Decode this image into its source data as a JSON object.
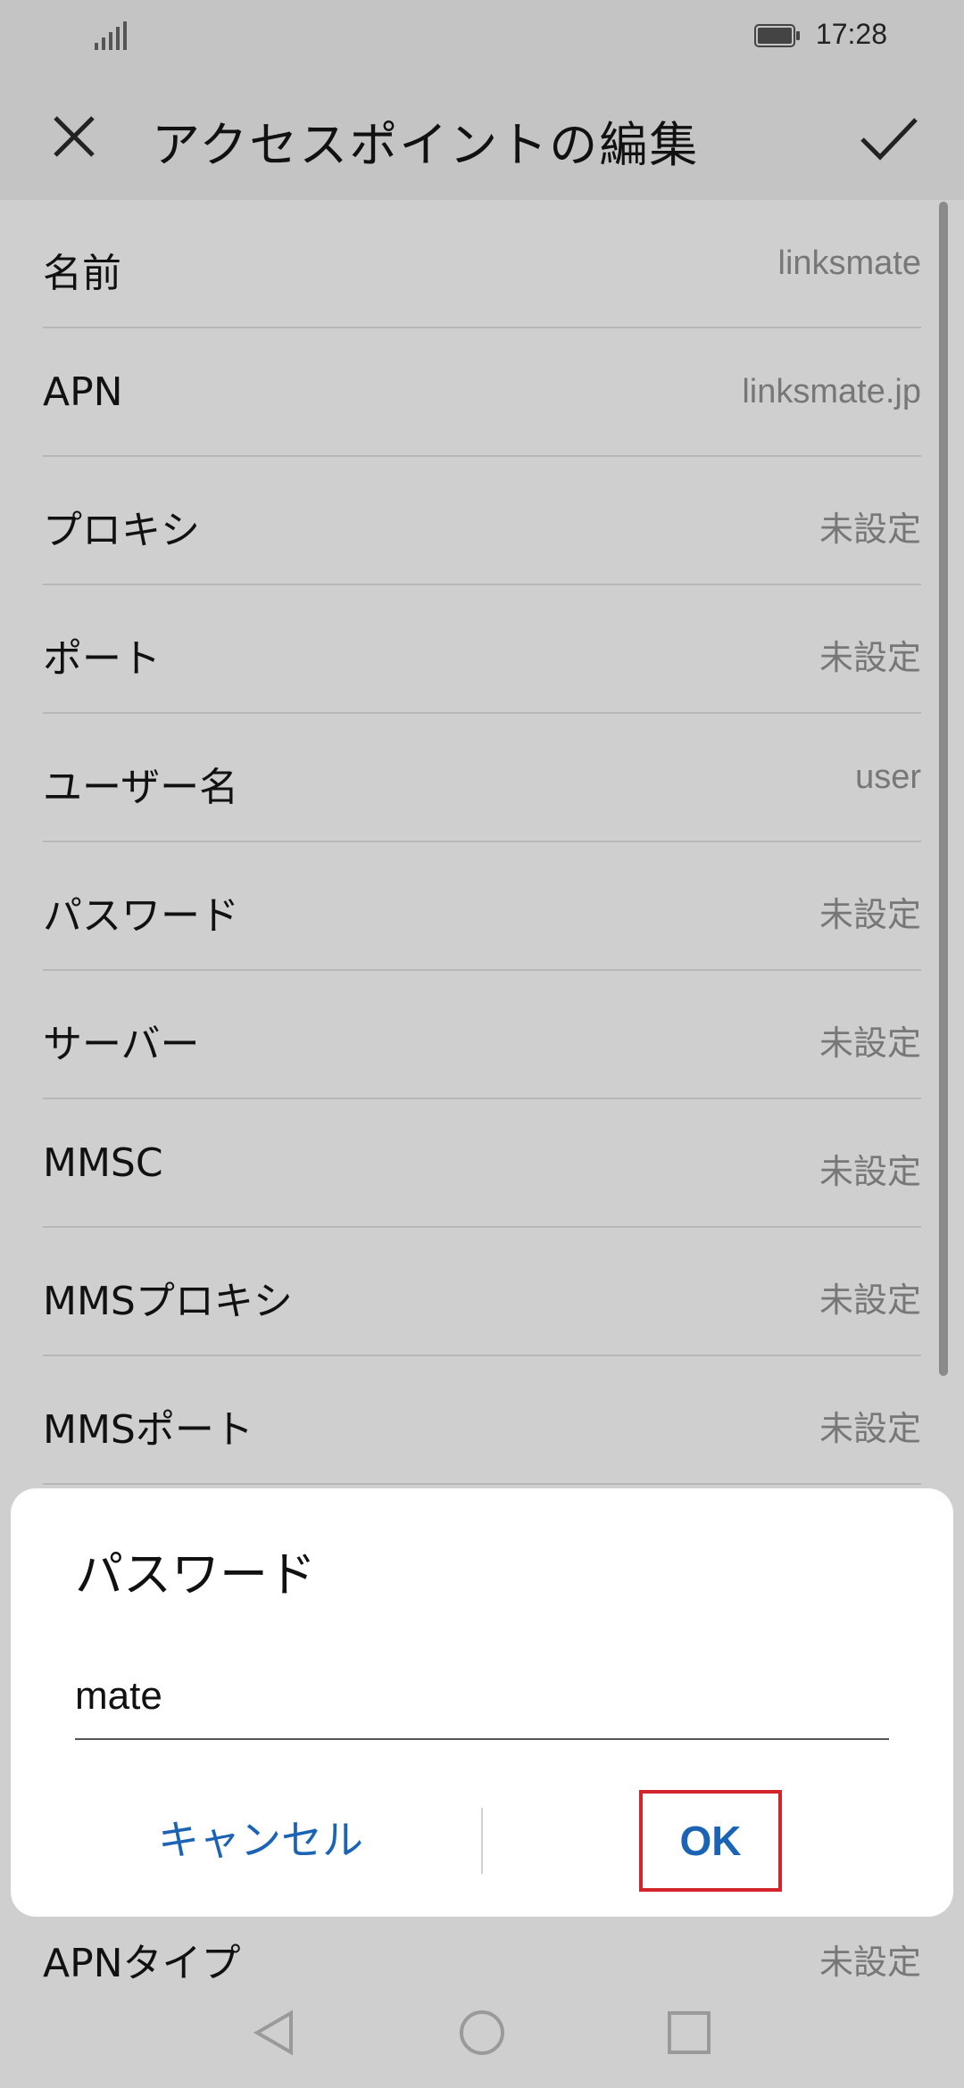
{
  "status_bar": {
    "time": "17:28"
  },
  "app_bar": {
    "title": "アクセスポイントの編集"
  },
  "rows": [
    {
      "label": "名前",
      "value": "linksmate"
    },
    {
      "label": "APN",
      "value": "linksmate.jp"
    },
    {
      "label": "プロキシ",
      "value": "未設定"
    },
    {
      "label": "ポート",
      "value": "未設定"
    },
    {
      "label": "ユーザー名",
      "value": "user"
    },
    {
      "label": "パスワード",
      "value": "未設定"
    },
    {
      "label": "サーバー",
      "value": "未設定"
    },
    {
      "label": "MMSC",
      "value": "未設定"
    },
    {
      "label": "MMSプロキシ",
      "value": "未設定"
    },
    {
      "label": "MMSポート",
      "value": "未設定"
    },
    {
      "label": "APNタイプ",
      "value": "未設定"
    }
  ],
  "dialog": {
    "title": "パスワード",
    "input_value": "mate",
    "cancel_label": "キャンセル",
    "ok_label": "OK"
  },
  "colors": {
    "accent": "#1a63b5",
    "highlight": "#d4242b",
    "dim_overlay": "#cfcfcf"
  },
  "icons": {
    "close": "close-icon",
    "confirm": "check-icon",
    "signal": "signal-icon",
    "battery": "battery-icon",
    "back": "nav-back-icon",
    "home": "nav-home-icon",
    "recent": "nav-recent-icon"
  }
}
